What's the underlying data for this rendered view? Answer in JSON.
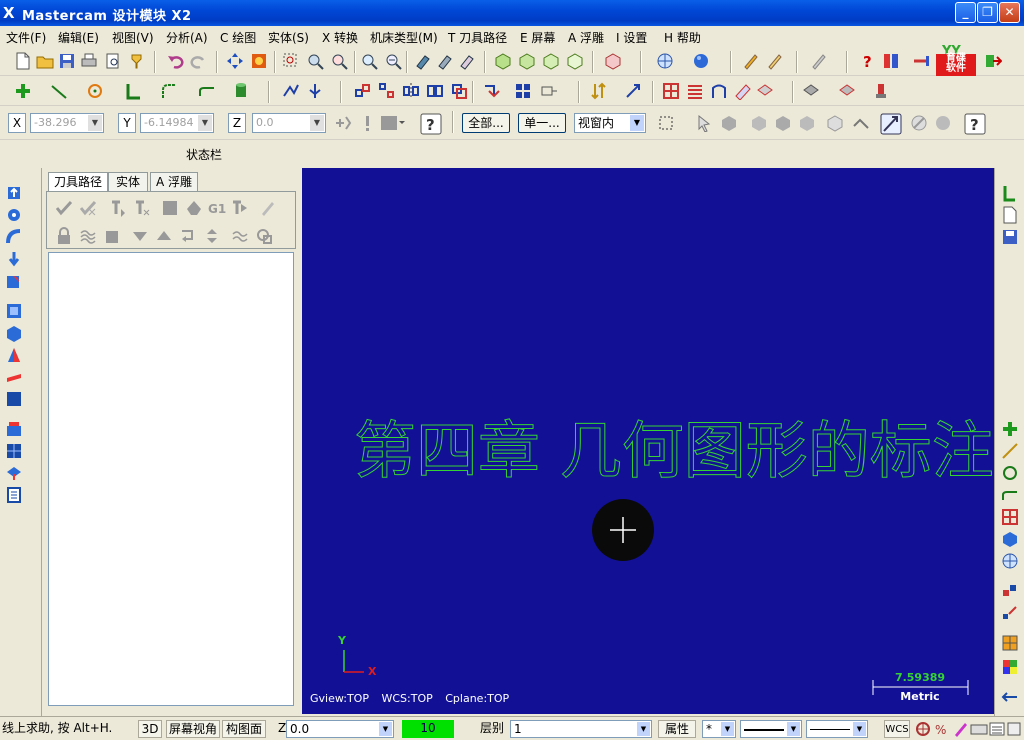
{
  "window": {
    "title": "Mastercam 设计模块  X2",
    "logo_glyph": "X",
    "minimize": "_",
    "restore": "❐",
    "close": "✕"
  },
  "menu": [
    "文件(F)",
    "编辑(E)",
    "视图(V)",
    "分析(A)",
    "C 绘图",
    "实体(S)",
    "X 转换",
    "机床类型(M)",
    "T 刀具路径",
    "E 屏幕",
    "A 浮雕",
    "I 设置",
    "H 帮助"
  ],
  "brand_logo": {
    "top": "YY",
    "line1": "育碟",
    "line2": "软件"
  },
  "coords": {
    "x_label": "X",
    "x_value": "-38.296",
    "y_label": "Y",
    "y_value": "-6.14984",
    "z_label": "Z",
    "z_value": "0.0"
  },
  "selection": {
    "all_button": "全部...",
    "single_button": "单一...",
    "mode_select": "视窗内"
  },
  "status_strip_label": "状态栏",
  "manager": {
    "tabs": [
      "刀具路径",
      "实体",
      "A 浮雕"
    ],
    "active_tab": 0
  },
  "viewport": {
    "heading": "第四章  几何图形的标注",
    "axis_y": "Y",
    "axis_x": "X",
    "gview": "Gview:TOP",
    "wcs": "WCS:TOP",
    "cplane": "Cplane:TOP",
    "scale_value": "7.59389",
    "scale_unit": "Metric",
    "background_color": "#121196",
    "text_color": "#34d234"
  },
  "statusbar": {
    "help_text": "线上求助, 按 Alt+H.",
    "mode_3d": "3D",
    "screen_view": "屏幕视角",
    "plane": "构图面",
    "z_label": "Z",
    "z_value": "0.0",
    "color_value": "10",
    "color_swatch": "#00e000",
    "level_label": "层别",
    "level_value": "1",
    "attributes": "属性",
    "point_style": "*",
    "wcs": "WCS"
  },
  "icons": {
    "toolbar1": [
      "new-file-icon",
      "open-file-icon",
      "save-icon",
      "print-icon",
      "print-preview-icon",
      "merge-icon",
      "undo-icon",
      "redo-icon",
      "pan-icon",
      "render-icon",
      "zoom-window-icon",
      "zoom-fit-icon",
      "zoom-in-icon",
      "zoom-prev-icon",
      "zoom-out-icon",
      "repaint-icon",
      "shade-icon",
      "wireframe-icon",
      "view-top-icon",
      "view-front-icon",
      "view-side-icon",
      "view-iso-icon",
      "view-box-icon",
      "globe-icon",
      "sphere-icon",
      "analyze-icon",
      "edit-icon",
      "pen-icon",
      "help-icon",
      "toolbar-config-icon",
      "link-icon",
      "exit-icon"
    ],
    "toolbar2": [
      "point-icon",
      "line-icon",
      "arc-icon",
      "fillet-icon",
      "chamfer-icon",
      "spline-icon",
      "cylinder-icon",
      "trim-icon",
      "break-icon",
      "transform-icon",
      "offset-icon",
      "mirror-icon",
      "rotate-icon",
      "scale-icon",
      "array-icon",
      "drag-icon",
      "dimension-icon",
      "hatch-icon",
      "grid-icon",
      "rect-icon",
      "curve-icon",
      "surface-icon",
      "solid-icon",
      "machine-icon",
      "tool-icon"
    ]
  }
}
